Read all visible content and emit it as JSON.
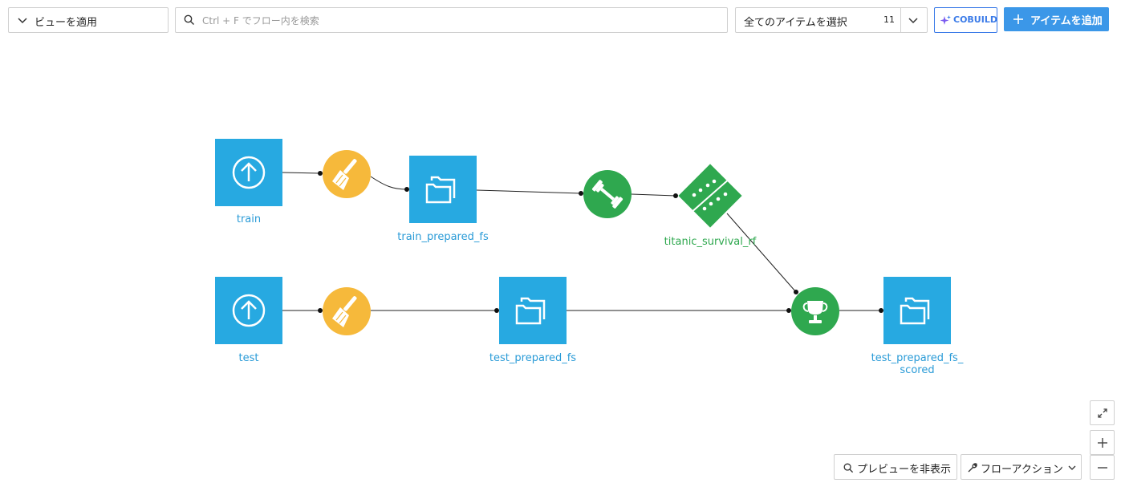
{
  "toolbar": {
    "view_label": "ビューを適用",
    "search_placeholder": "Ctrl + F でフロー内を検索",
    "select_label": "全てのアイテムを選択",
    "select_count": "11",
    "cobuild_label": "COBUILD",
    "add_item_label": "アイテムを追加"
  },
  "flow": {
    "nodes": {
      "train": "train",
      "train_prepared_fs": "train_prepared_fs",
      "titanic_survival_rf": "titanic_survival_rf",
      "test": "test",
      "test_prepared_fs": "test_prepared_fs",
      "test_prepared_fs_scored_line1": "test_prepared_fs_",
      "test_prepared_fs_scored_line2": "scored"
    }
  },
  "bottom": {
    "hide_preview_label": "プレビューを非表示",
    "flow_actions_label": "フローアクション"
  },
  "colors": {
    "dataset_blue": "#27a9e1",
    "recipe_yellow": "#f6b93b",
    "ml_green": "#2fa84f",
    "accent_blue": "#3b97e8",
    "label_blue": "#2a9bd7",
    "cobuild_border": "#3b7be8"
  },
  "icons": {
    "view": "chevron-down-icon",
    "search": "search-icon",
    "select": "chevron-down-icon",
    "cobuild": "sparkle-icon",
    "add": "plus-icon",
    "upload": "upload-icon",
    "prepare": "broom-icon",
    "folder": "folder-icon",
    "train": "dumbbell-icon",
    "model": "saved-model-icon",
    "score": "trophy-icon",
    "expand": "expand-icon",
    "zoom_in": "plus-icon",
    "zoom_out": "minus-icon",
    "wrench": "wrench-icon"
  }
}
